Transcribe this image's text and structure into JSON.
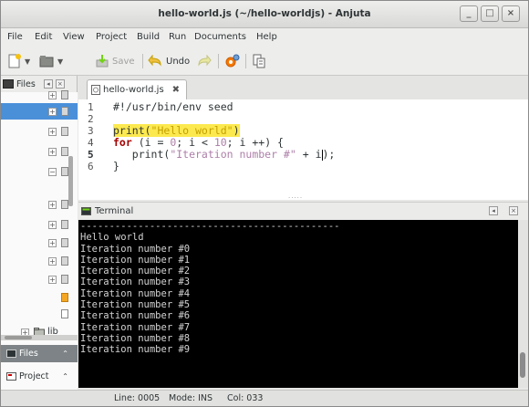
{
  "window": {
    "title": "hello-world.js (~/hello-worldjs) - Anjuta",
    "minimize_glyph": "_",
    "maximize_glyph": "□",
    "close_glyph": "×"
  },
  "menubar": {
    "items": [
      "File",
      "Edit",
      "View",
      "Project",
      "Build",
      "Run",
      "Documents",
      "Help"
    ]
  },
  "toolbar": {
    "save_label": "Save",
    "undo_label": "Undo"
  },
  "sidebar": {
    "header_label": "Files",
    "lib_label": "lib",
    "tabs": [
      {
        "label": "Files",
        "icon": "files-icon"
      },
      {
        "label": "Project",
        "icon": "project-icon"
      }
    ]
  },
  "editor": {
    "tab_label": "hello-world.js",
    "line_numbers": [
      "1",
      "2",
      "3",
      "4",
      "5",
      "6"
    ],
    "current_line": "5",
    "lines": [
      "#!/usr/bin/env seed",
      "",
      "print(\"Hello world\")",
      "for (i = 0; i < 10; i ++) {",
      "   print(\"Iteration number #\" + i);",
      "}"
    ]
  },
  "terminal": {
    "title": "Terminal",
    "separator": "---------------------------------------------",
    "output": [
      "Hello world",
      "Iteration number #0",
      "Iteration number #1",
      "Iteration number #2",
      "Iteration number #3",
      "Iteration number #4",
      "Iteration number #5",
      "Iteration number #6",
      "Iteration number #7",
      "Iteration number #8",
      "Iteration number #9"
    ]
  },
  "statusbar": {
    "line": "Line: 0005",
    "mode": "Mode: INS",
    "col": "Col: 033"
  },
  "colors": {
    "selection": "#4a90d9",
    "highlight": "#fce94f",
    "keyword": "#a40000",
    "string": "#c4a000",
    "terminal_bg": "#000000"
  }
}
